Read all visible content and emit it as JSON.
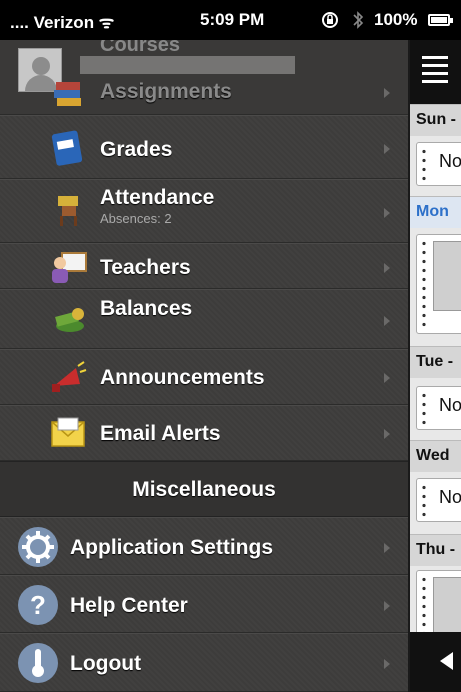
{
  "status_bar": {
    "carrier": ".... Verizon ᯤ",
    "time": "5:09 PM",
    "battery": "100%",
    "lock_icon": "rotation-lock-icon",
    "bluetooth_icon": "bluetooth-icon"
  },
  "menu": {
    "partial_top_label": "Courses",
    "items": [
      {
        "label": "Assignments",
        "icon": "books-icon"
      },
      {
        "label": "Grades",
        "icon": "grade-book-icon"
      },
      {
        "label": "Attendance",
        "sublabel": "Absences: 2",
        "icon": "desk-icon"
      },
      {
        "label": "Teachers",
        "icon": "teacher-icon"
      },
      {
        "label": "Balances",
        "icon": "money-icon"
      },
      {
        "label": "Announcements",
        "icon": "megaphone-icon"
      },
      {
        "label": "Email Alerts",
        "icon": "envelope-icon"
      }
    ],
    "section_title": "Miscellaneous",
    "misc_items": [
      {
        "label": "Application Settings",
        "icon": "gear-icon"
      },
      {
        "label": "Help Center",
        "icon": "help-icon"
      },
      {
        "label": "Logout",
        "icon": "thermometer-icon"
      }
    ]
  },
  "panel": {
    "days": [
      "Sun -",
      "Mon",
      "Tue -",
      "Wed",
      "Thu -"
    ],
    "no_label": "No"
  }
}
